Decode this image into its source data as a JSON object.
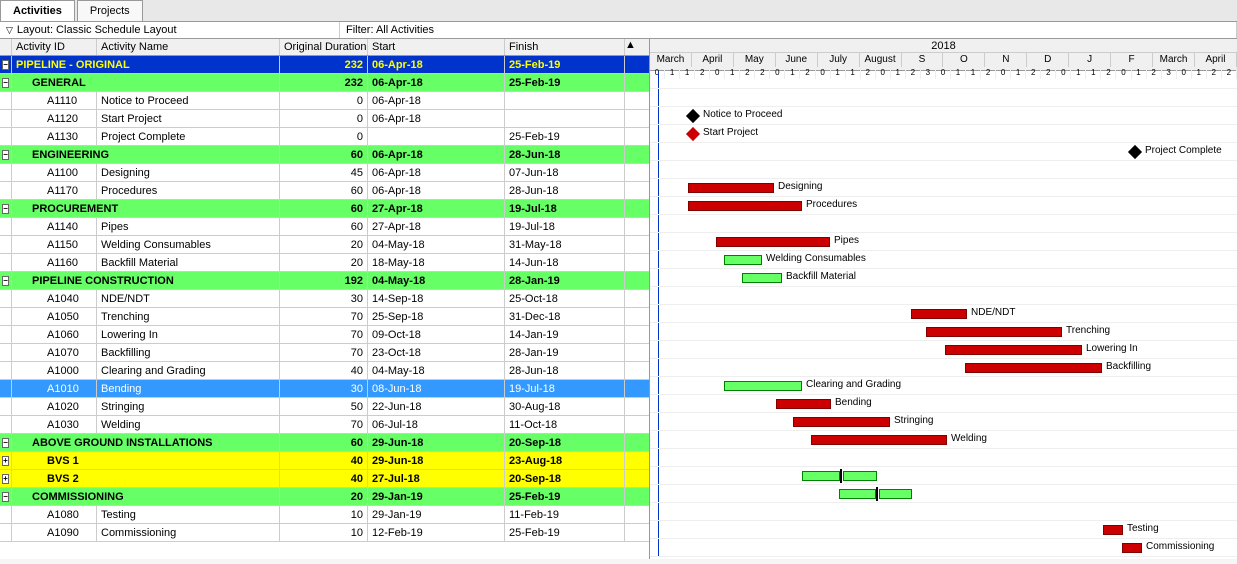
{
  "tabs": {
    "activities": "Activities",
    "projects": "Projects"
  },
  "toolbar": {
    "layoutLabel": "Layout: Classic Schedule Layout",
    "filterLabel": "Filter: All Activities"
  },
  "columns": {
    "id": "Activity ID",
    "name": "Activity Name",
    "dur": "Original Duration",
    "start": "Start",
    "finish": "Finish"
  },
  "timeline": {
    "year": "2018",
    "months": [
      "March",
      "April",
      "May",
      "June",
      "July",
      "August",
      "S",
      "O",
      "N",
      "D",
      "J",
      "F",
      "March",
      "April"
    ],
    "days": [
      "0",
      "1",
      "1",
      "2",
      "0",
      "1",
      "2",
      "2",
      "0",
      "1",
      "2",
      "0",
      "1",
      "1",
      "2",
      "0",
      "1",
      "2",
      "3",
      "0",
      "1",
      "1",
      "2",
      "0",
      "1",
      "2",
      "2",
      "0",
      "1",
      "1",
      "2",
      "0",
      "1",
      "2",
      "3",
      "0",
      "1",
      "2",
      "2"
    ]
  },
  "rows": [
    {
      "type": "lvl1",
      "toggle": "-",
      "id": "",
      "name": "PIPELINE - ORIGINAL",
      "dur": "232",
      "start": "06-Apr-18",
      "finish": "25-Feb-19"
    },
    {
      "type": "lvl2",
      "toggle": "-",
      "id": "",
      "name": "GENERAL",
      "dur": "232",
      "start": "06-Apr-18",
      "finish": "25-Feb-19",
      "indent": 1
    },
    {
      "type": "act",
      "id": "A1110",
      "name": "Notice to Proceed",
      "dur": "0",
      "start": "06-Apr-18",
      "finish": "",
      "gType": "ms",
      "gStart": 38,
      "gLabel": "Notice to Proceed"
    },
    {
      "type": "act",
      "id": "A1120",
      "name": "Start Project",
      "dur": "0",
      "start": "06-Apr-18",
      "finish": "",
      "gType": "ms",
      "gStart": 38,
      "gLabel": "Start Project",
      "gMsRed": true
    },
    {
      "type": "act",
      "id": "A1130",
      "name": "Project Complete",
      "dur": "0",
      "start": "",
      "finish": "25-Feb-19",
      "gType": "ms",
      "gStart": 480,
      "gLabel": "Project Complete"
    },
    {
      "type": "lvl2",
      "toggle": "-",
      "id": "",
      "name": "ENGINEERING",
      "dur": "60",
      "start": "06-Apr-18",
      "finish": "28-Jun-18",
      "indent": 1
    },
    {
      "type": "act",
      "id": "A1100",
      "name": "Designing",
      "dur": "45",
      "start": "06-Apr-18",
      "finish": "07-Jun-18",
      "gType": "red",
      "gStart": 38,
      "gEnd": 124,
      "gLabel": "Designing"
    },
    {
      "type": "act",
      "id": "A1170",
      "name": "Procedures",
      "dur": "60",
      "start": "06-Apr-18",
      "finish": "28-Jun-18",
      "gType": "red",
      "gStart": 38,
      "gEnd": 152,
      "gLabel": "Procedures"
    },
    {
      "type": "lvl2",
      "toggle": "-",
      "id": "",
      "name": "PROCUREMENT",
      "dur": "60",
      "start": "27-Apr-18",
      "finish": "19-Jul-18",
      "indent": 1
    },
    {
      "type": "act",
      "id": "A1140",
      "name": "Pipes",
      "dur": "60",
      "start": "27-Apr-18",
      "finish": "19-Jul-18",
      "gType": "red",
      "gStart": 66,
      "gEnd": 180,
      "gLabel": "Pipes"
    },
    {
      "type": "act",
      "id": "A1150",
      "name": "Welding Consumables",
      "dur": "20",
      "start": "04-May-18",
      "finish": "31-May-18",
      "gType": "green",
      "gStart": 74,
      "gEnd": 112,
      "gLabel": "Welding Consumables"
    },
    {
      "type": "act",
      "id": "A1160",
      "name": "Backfill Material",
      "dur": "20",
      "start": "18-May-18",
      "finish": "14-Jun-18",
      "gType": "green",
      "gStart": 92,
      "gEnd": 132,
      "gLabel": "Backfill Material"
    },
    {
      "type": "lvl2",
      "toggle": "-",
      "id": "",
      "name": "PIPELINE CONSTRUCTION",
      "dur": "192",
      "start": "04-May-18",
      "finish": "28-Jan-19",
      "indent": 1
    },
    {
      "type": "act",
      "id": "A1040",
      "name": "NDE/NDT",
      "dur": "30",
      "start": "14-Sep-18",
      "finish": "25-Oct-18",
      "gType": "red",
      "gStart": 261,
      "gEnd": 317,
      "gLabel": "NDE/NDT"
    },
    {
      "type": "act",
      "id": "A1050",
      "name": "Trenching",
      "dur": "70",
      "start": "25-Sep-18",
      "finish": "31-Dec-18",
      "gType": "red",
      "gStart": 276,
      "gEnd": 412,
      "gLabel": "Trenching"
    },
    {
      "type": "act",
      "id": "A1060",
      "name": "Lowering In",
      "dur": "70",
      "start": "09-Oct-18",
      "finish": "14-Jan-19",
      "gType": "red",
      "gStart": 295,
      "gEnd": 432,
      "gLabel": "Lowering In"
    },
    {
      "type": "act",
      "id": "A1070",
      "name": "Backfilling",
      "dur": "70",
      "start": "23-Oct-18",
      "finish": "28-Jan-19",
      "gType": "red",
      "gStart": 315,
      "gEnd": 452,
      "gLabel": "Backfilling"
    },
    {
      "type": "act",
      "id": "A1000",
      "name": "Clearing and Grading",
      "dur": "40",
      "start": "04-May-18",
      "finish": "28-Jun-18",
      "gType": "green",
      "gStart": 74,
      "gEnd": 152,
      "gLabel": "Clearing and Grading"
    },
    {
      "type": "sel",
      "id": "A1010",
      "name": "Bending",
      "dur": "30",
      "start": "08-Jun-18",
      "finish": "19-Jul-18",
      "gType": "red",
      "gStart": 126,
      "gEnd": 181,
      "gLabel": "Bending"
    },
    {
      "type": "act",
      "id": "A1020",
      "name": "Stringing",
      "dur": "50",
      "start": "22-Jun-18",
      "finish": "30-Aug-18",
      "gType": "red",
      "gStart": 143,
      "gEnd": 240,
      "gLabel": "Stringing"
    },
    {
      "type": "act",
      "id": "A1030",
      "name": "Welding",
      "dur": "70",
      "start": "06-Jul-18",
      "finish": "11-Oct-18",
      "gType": "red",
      "gStart": 161,
      "gEnd": 297,
      "gLabel": "Welding"
    },
    {
      "type": "lvl2",
      "toggle": "-",
      "id": "",
      "name": "ABOVE GROUND INSTALLATIONS",
      "dur": "60",
      "start": "29-Jun-18",
      "finish": "20-Sep-18",
      "indent": 1
    },
    {
      "type": "lvl3",
      "toggle": "+",
      "id": "",
      "name": "BVS 1",
      "dur": "40",
      "start": "29-Jun-18",
      "finish": "23-Aug-18",
      "indent": 2,
      "gType": "sumgreen",
      "gStart": 152,
      "gEnd": 227
    },
    {
      "type": "lvl3",
      "toggle": "+",
      "id": "",
      "name": "BVS 2",
      "dur": "40",
      "start": "27-Jul-18",
      "finish": "20-Sep-18",
      "indent": 2,
      "gType": "sumgreen",
      "gStart": 189,
      "gEnd": 262
    },
    {
      "type": "lvl2",
      "toggle": "-",
      "id": "",
      "name": "COMMISSIONING",
      "dur": "20",
      "start": "29-Jan-19",
      "finish": "25-Feb-19",
      "indent": 1
    },
    {
      "type": "act",
      "id": "A1080",
      "name": "Testing",
      "dur": "10",
      "start": "29-Jan-19",
      "finish": "11-Feb-19",
      "gType": "red",
      "gStart": 453,
      "gEnd": 473,
      "gLabel": "Testing"
    },
    {
      "type": "act",
      "id": "A1090",
      "name": "Commissioning",
      "dur": "10",
      "start": "12-Feb-19",
      "finish": "25-Feb-19",
      "gType": "red",
      "gStart": 472,
      "gEnd": 492,
      "gLabel": "Commissioning"
    }
  ]
}
